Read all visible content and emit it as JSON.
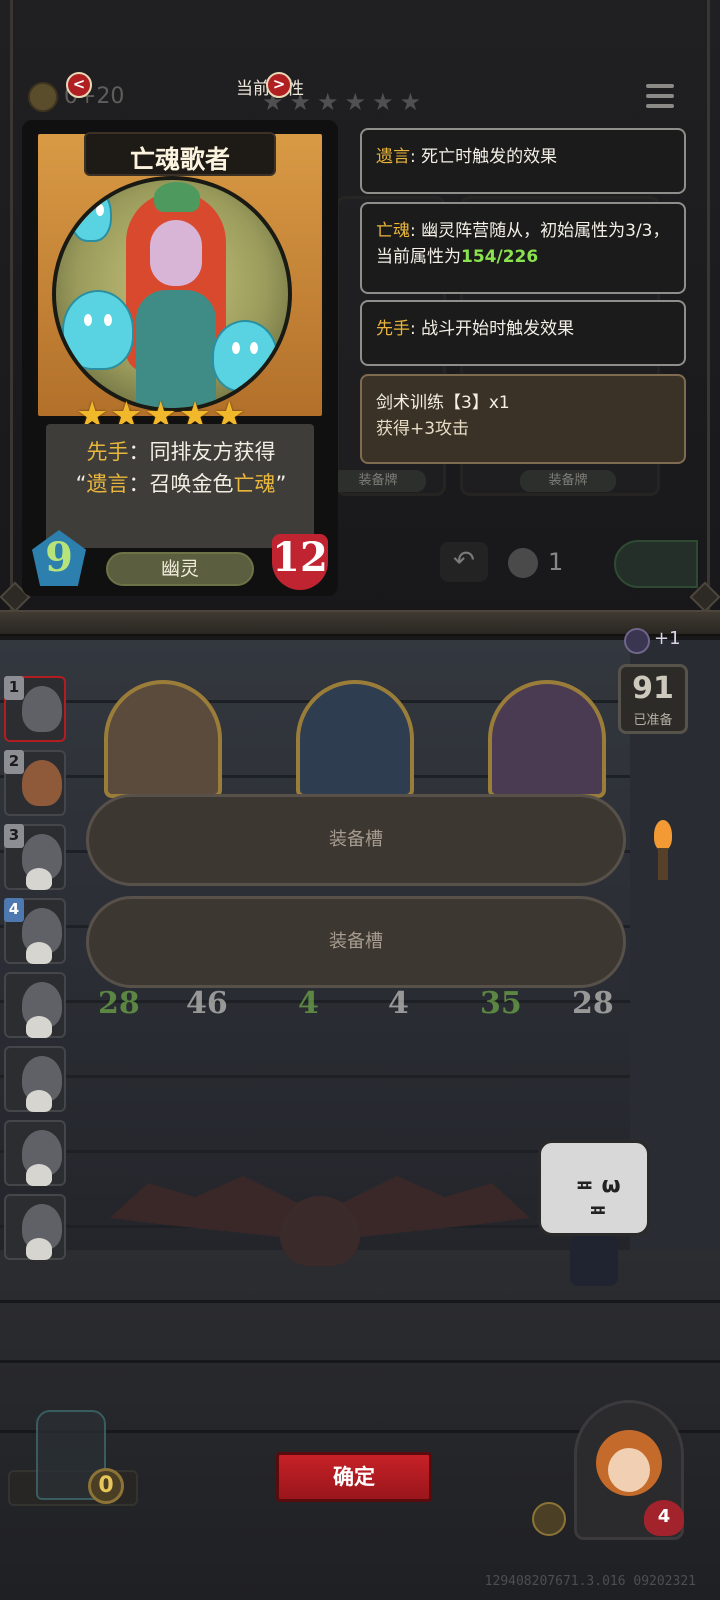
{
  "header": {
    "coins": "0+20",
    "title": "当前属性",
    "prev_arrow": "<",
    "next_arrow": ">",
    "bg_stars": "★★★★★★"
  },
  "card": {
    "name": "亡魂歌者",
    "star_count": 5,
    "star_glyph": "★",
    "desc": {
      "kw1": "先手",
      "text1": "：同排友方获得",
      "quote_open": "“",
      "kw2": "遗言",
      "text2": "：召唤金色",
      "kw3": "亡魂",
      "quote_close": "”"
    },
    "type": "幽灵",
    "attack": "9",
    "health": "12"
  },
  "info": [
    {
      "keyword": "遗言",
      "text": ": 死亡时触发的效果"
    },
    {
      "keyword": "亡魂",
      "text": ": 幽灵阵营随从，初始属性为3/3，当前属性为",
      "highlight": "154/226"
    },
    {
      "keyword": "先手",
      "text": ": 战斗开始时触发效果"
    }
  ],
  "equipment": {
    "line1": "剑术训练【3】x1",
    "line2": "获得+3攻击"
  },
  "background": {
    "tag_left": "装备牌",
    "tag_right": "装备牌",
    "undo_glyph": "↶",
    "count": "1"
  },
  "queue": {
    "numbers": [
      "1",
      "2",
      "3",
      "4"
    ]
  },
  "board": {
    "chars": [
      {
        "attack": "28",
        "health": "46"
      },
      {
        "attack": "4",
        "health": "4"
      },
      {
        "attack": "35",
        "health": "28"
      }
    ],
    "slots": [
      "装备槽",
      "装备槽"
    ]
  },
  "ready": {
    "moon_bonus": "+1",
    "count": "91",
    "label": "已准备"
  },
  "mascot": {
    "face": "≖ ω ≖"
  },
  "bottom": {
    "bag_coins": "0",
    "confirm": "确定",
    "player_hp": "4",
    "version": "129408207671.3.016 09202321"
  },
  "colors": {
    "keyword": "#e9b63b",
    "highlight": "#8be24f",
    "confirm": "#c62127"
  }
}
